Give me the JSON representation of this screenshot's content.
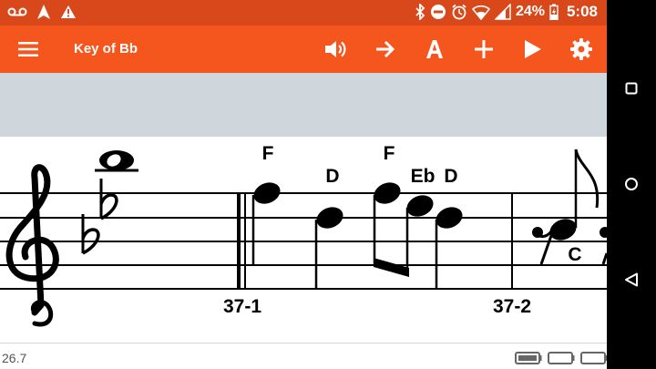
{
  "status_bar": {
    "icons": [
      "voicemail-icon",
      "navigation-icon",
      "warning-icon",
      "bluetooth-icon",
      "do-not-disturb-icon",
      "alarm-icon",
      "wifi-icon",
      "signal-icon",
      "battery-charging-icon"
    ],
    "battery_percent": "24%",
    "time": "5:08"
  },
  "toolbar": {
    "menu_icon": "hamburger-menu-icon",
    "title": "Key of Bb",
    "buttons": [
      "volume-icon",
      "arrow-right-icon",
      "letter-a-icon",
      "plus-icon",
      "play-icon",
      "settings-gear-icon"
    ]
  },
  "score": {
    "key_label": "Bb",
    "notes": {
      "n1": "F",
      "n2": "D",
      "n3": "F",
      "n4": "Eb",
      "n5": "D",
      "n6": "C"
    },
    "measure_1": "37-1",
    "measure_2": "37-2"
  },
  "footer": {
    "version": "26.7",
    "battery_icons": [
      "battery-full-icon",
      "battery-empty-icon",
      "battery-empty-icon"
    ]
  },
  "nav_bar": {
    "buttons": [
      "recents-square-icon",
      "home-circle-icon",
      "back-triangle-icon"
    ]
  },
  "colors": {
    "status_bar": "#d9481b",
    "app_bar": "#f4561e",
    "key_label": "#e02020",
    "band": "#cfd7dd"
  }
}
